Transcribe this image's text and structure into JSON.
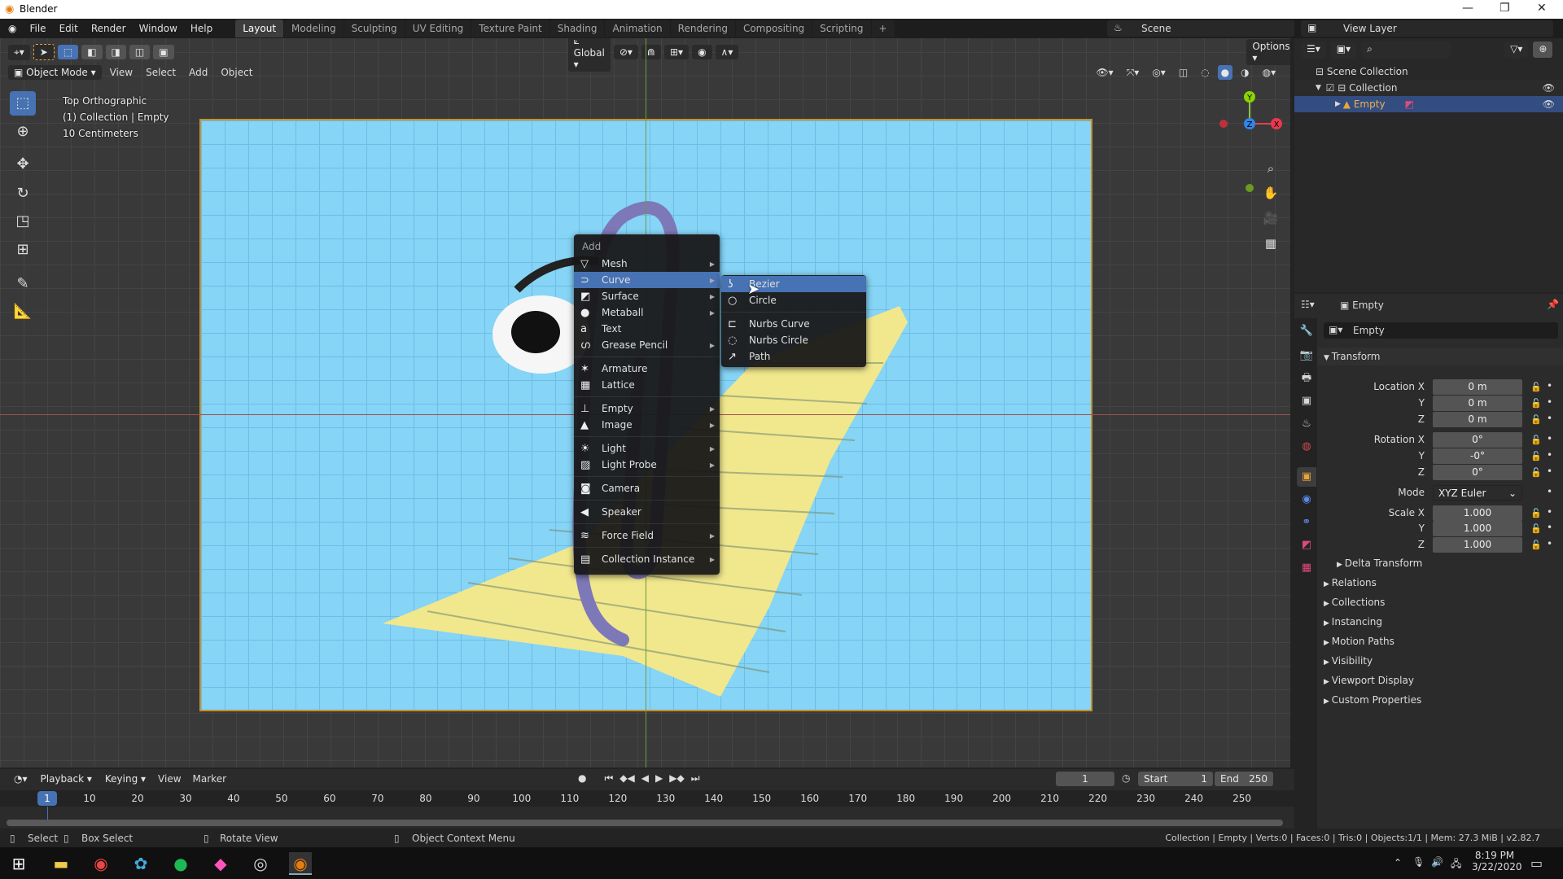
{
  "window": {
    "title": "Blender",
    "minimize": "—",
    "maximize": "❐",
    "close": "✕"
  },
  "menus": [
    "File",
    "Edit",
    "Render",
    "Window",
    "Help"
  ],
  "workspaces": [
    "Layout",
    "Modeling",
    "Sculpting",
    "UV Editing",
    "Texture Paint",
    "Shading",
    "Animation",
    "Rendering",
    "Compositing",
    "Scripting",
    "+"
  ],
  "active_workspace": "Layout",
  "scene": "Scene",
  "view_layer": "View Layer",
  "viewport": {
    "orientation": "Global",
    "options": "Options",
    "mode": "Object Mode",
    "header_menus": [
      "View",
      "Select",
      "Add",
      "Object"
    ],
    "overlay_lines": [
      "Top Orthographic",
      "(1) Collection | Empty",
      "10 Centimeters"
    ],
    "gizmo": {
      "x": "X",
      "y": "Y",
      "z": "Z"
    }
  },
  "add_menu": {
    "title": "Add",
    "groups": [
      [
        {
          "label": "Mesh",
          "icon": "▽",
          "sub": true
        },
        {
          "label": "Curve",
          "icon": "⊃",
          "sub": true,
          "highlighted": true
        },
        {
          "label": "Surface",
          "icon": "◩",
          "sub": true
        },
        {
          "label": "Metaball",
          "icon": "●",
          "sub": true
        },
        {
          "label": "Text",
          "icon": "a",
          "sub": false
        },
        {
          "label": "Grease Pencil",
          "icon": "ഗ",
          "sub": true
        }
      ],
      [
        {
          "label": "Armature",
          "icon": "✶",
          "sub": false
        },
        {
          "label": "Lattice",
          "icon": "▦",
          "sub": false
        }
      ],
      [
        {
          "label": "Empty",
          "icon": "⊥",
          "sub": true
        },
        {
          "label": "Image",
          "icon": "▲",
          "sub": true
        }
      ],
      [
        {
          "label": "Light",
          "icon": "☀",
          "sub": true
        },
        {
          "label": "Light Probe",
          "icon": "▨",
          "sub": true
        }
      ],
      [
        {
          "label": "Camera",
          "icon": "◙",
          "sub": false
        }
      ],
      [
        {
          "label": "Speaker",
          "icon": "◀",
          "sub": false
        }
      ],
      [
        {
          "label": "Force Field",
          "icon": "≋",
          "sub": true
        }
      ],
      [
        {
          "label": "Collection Instance",
          "icon": "▤",
          "sub": true
        }
      ]
    ]
  },
  "curve_submenu": [
    [
      {
        "label": "Bezier",
        "icon": "ʖ",
        "highlighted": true
      },
      {
        "label": "Circle",
        "icon": "○"
      }
    ],
    [
      {
        "label": "Nurbs Curve",
        "icon": "⊏"
      },
      {
        "label": "Nurbs Circle",
        "icon": "◌"
      },
      {
        "label": "Path",
        "icon": "↗"
      }
    ]
  ],
  "outliner": {
    "root": "Scene Collection",
    "collection": "Collection",
    "object": "Empty"
  },
  "properties": {
    "header": "Empty",
    "name": "Empty",
    "section": "Transform",
    "location": {
      "label": "Location X",
      "x": "0 m",
      "y": "0 m",
      "z": "0 m"
    },
    "rotation": {
      "label": "Rotation X",
      "x": "0°",
      "y": "-0°",
      "z": "0°"
    },
    "mode": {
      "label": "Mode",
      "value": "XYZ Euler"
    },
    "scale": {
      "label": "Scale X",
      "x": "1.000",
      "y": "1.000",
      "z": "1.000"
    },
    "axis_y": "Y",
    "axis_z": "Z",
    "subsection": "Delta Transform",
    "collapsed": [
      "Relations",
      "Collections",
      "Instancing",
      "Motion Paths",
      "Visibility",
      "Viewport Display",
      "Custom Properties"
    ]
  },
  "timeline": {
    "menus": [
      "Playback",
      "Keying",
      "View",
      "Marker"
    ],
    "current_frame": "1",
    "start_label": "Start",
    "start": "1",
    "end_label": "End",
    "end": "250",
    "ticks": [
      10,
      20,
      30,
      40,
      50,
      60,
      70,
      80,
      90,
      100,
      110,
      120,
      130,
      140,
      150,
      160,
      170,
      180,
      190,
      200,
      210,
      220,
      230,
      240,
      250
    ]
  },
  "status": {
    "select": "Select",
    "box_select": "Box Select",
    "rotate": "Rotate View",
    "context": "Object Context Menu",
    "stats": "Collection | Empty | Verts:0 | Faces:0 | Tris:0 | Objects:1/1 | Mem: 27.3 MiB | v2.82.7"
  },
  "taskbar": {
    "time": "8:19 PM",
    "date": "3/22/2020"
  },
  "colors": {
    "accent": "#4772b3",
    "camera_bg": "#86d4f6",
    "paper": "#f3e98f",
    "active_orange": "#e8a43a"
  }
}
